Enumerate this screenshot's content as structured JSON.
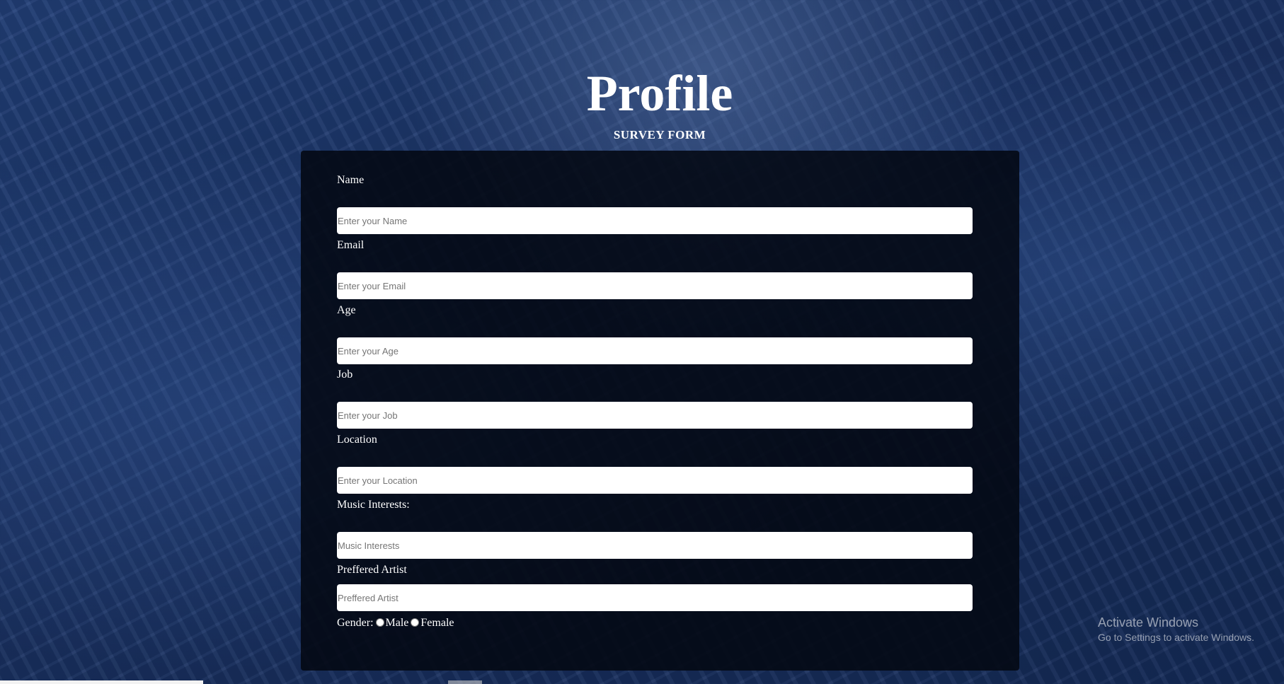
{
  "header": {
    "title": "Profile",
    "subtitle": "SURVEY FORM"
  },
  "form": {
    "fields": [
      {
        "label": "Name",
        "placeholder": "Enter your Name"
      },
      {
        "label": "Email",
        "placeholder": "Enter your Email"
      },
      {
        "label": "Age",
        "placeholder": "Enter your Age"
      },
      {
        "label": "Job",
        "placeholder": "Enter your Job"
      },
      {
        "label": "Location",
        "placeholder": "Enter your Location"
      },
      {
        "label": "Music Interests:",
        "placeholder": "Music Interests"
      },
      {
        "label": "Preffered Artist",
        "placeholder": "Preffered Artist"
      }
    ],
    "gender": {
      "label": "Gender:",
      "options": [
        "Male",
        "Female"
      ]
    }
  },
  "watermark": {
    "title": "Activate Windows",
    "subtitle": "Go to Settings to activate Windows."
  },
  "colors": {
    "background": "#1b3466",
    "panel": "#03080f",
    "input": "#ffffff",
    "text": "#ffffff"
  }
}
